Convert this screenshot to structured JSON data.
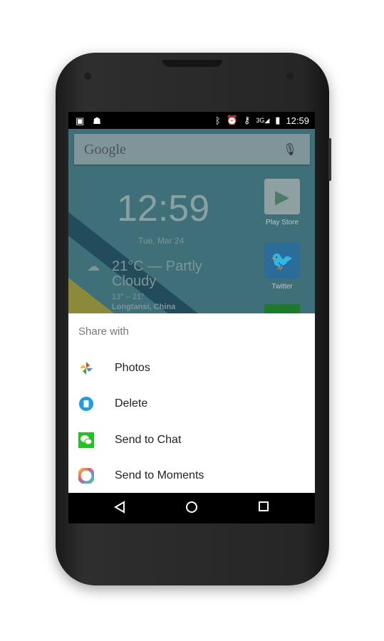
{
  "status_bar": {
    "time": "12:59",
    "network": "3G",
    "icons": [
      "image-icon",
      "android-icon",
      "bluetooth-icon",
      "alarm-icon",
      "vpn-key-icon",
      "signal-icon",
      "battery-charging-icon"
    ]
  },
  "home": {
    "search_logo": "Google",
    "clock": "12:59",
    "date": "Tue, Mar 24",
    "weather": {
      "condition": "21°C — Partly Cloudy",
      "range": "13° – 21°",
      "location": "Longtansi, China"
    },
    "apps": [
      {
        "label": "Play Store"
      },
      {
        "label": "Twitter"
      }
    ]
  },
  "share_sheet": {
    "title": "Share with",
    "items": [
      {
        "label": "Photos",
        "icon": "pinwheel-icon"
      },
      {
        "label": "Delete",
        "icon": "trash-icon",
        "color": "#1a9fe6"
      },
      {
        "label": "Send to Chat",
        "icon": "wechat-icon",
        "color": "#1ec51e"
      },
      {
        "label": "Send to Moments",
        "icon": "camera-aperture-icon"
      }
    ]
  },
  "nav_bar": {
    "buttons": [
      "back",
      "home",
      "recents"
    ]
  }
}
